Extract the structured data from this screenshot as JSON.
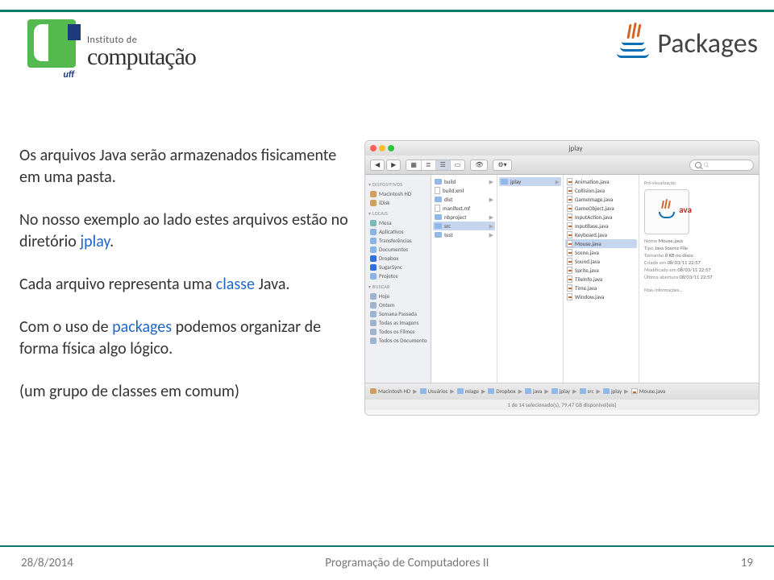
{
  "header": {
    "institute_small": "Instituto de",
    "institute_word": "computação",
    "uff_abbrev": "uff"
  },
  "title": "Packages",
  "paragraphs": {
    "p1a": "Os arquivos Java serão armazenados fisicamente em uma pasta.",
    "p2a": "No nosso exemplo ao lado estes arquivos estão no diretório ",
    "p2b": "jplay",
    "p2c": ".",
    "p3a": "Cada arquivo representa uma ",
    "p3b": "classe",
    "p3c": " Java.",
    "p4a": "Com o uso de ",
    "p4b": "packages",
    "p4c": " podemos organizar de forma física algo lógico.",
    "p5": "(um grupo de classes em comum)"
  },
  "finder": {
    "window_title": "jplay",
    "search_placeholder": "Q",
    "sidebar": {
      "sec1": "DISPOSITIVOS",
      "devices": [
        "Macintosh HD",
        "iDisk"
      ],
      "sec2": "LOCAIS",
      "places": [
        "Mesa",
        "Aplicativos",
        "Transferências",
        "Documentos",
        "Dropbox",
        "SugarSync",
        "Projetos"
      ],
      "sec3": "BUSCAR",
      "search_items": [
        "Hoje",
        "Ontem",
        "Semana Passada",
        "Todas as Imagens",
        "Todos os Filmes",
        "Todos os Documentos"
      ]
    },
    "col1": [
      {
        "name": "build",
        "type": "folder"
      },
      {
        "name": "build.xml",
        "type": "file"
      },
      {
        "name": "dist",
        "type": "folder"
      },
      {
        "name": "manifest.mf",
        "type": "file"
      },
      {
        "name": "nbproject",
        "type": "folder"
      },
      {
        "name": "src",
        "type": "folder",
        "selected": true
      },
      {
        "name": "test",
        "type": "folder"
      }
    ],
    "col2": [
      {
        "name": "jplay",
        "type": "folder",
        "selected": true
      }
    ],
    "col3": [
      {
        "name": "Animation.java"
      },
      {
        "name": "Collision.java"
      },
      {
        "name": "GameImage.java"
      },
      {
        "name": "GameObject.java"
      },
      {
        "name": "InputAction.java"
      },
      {
        "name": "InputBase.java"
      },
      {
        "name": "Keyboard.java"
      },
      {
        "name": "Mouse.java",
        "selected": true
      },
      {
        "name": "Scene.java"
      },
      {
        "name": "Sound.java"
      },
      {
        "name": "Sprite.java"
      },
      {
        "name": "TileInfo.java"
      },
      {
        "name": "Time.java"
      },
      {
        "name": "Window.java"
      }
    ],
    "preview": {
      "heading": "Pré-visualização",
      "java_label": "ava",
      "meta": {
        "name_l": "Nome",
        "name_v": "Mouse.java",
        "type_l": "Tipo",
        "type_v": "Java Source File",
        "size_l": "Tamanho",
        "size_v": "8 KB no disco",
        "created_l": "Criado em",
        "created_v": "08/03/11 22:57",
        "modified_l": "Modificado em",
        "modified_v": "08/03/11 22:57",
        "opened_l": "Última abertura",
        "opened_v": "08/03/11 22:57"
      },
      "more": "Mais informações..."
    },
    "crumbs": [
      "Macintosh HD",
      "Usuários",
      "mlage",
      "Dropbox",
      "java",
      "jplay",
      "src",
      "jplay",
      "Mouse.java"
    ],
    "status": "1 de 14 selecionado(s), 79,47 GB disponível(eis)"
  },
  "footer": {
    "date": "28/8/2014",
    "course": "Programação de Computadores II",
    "page": "19"
  }
}
